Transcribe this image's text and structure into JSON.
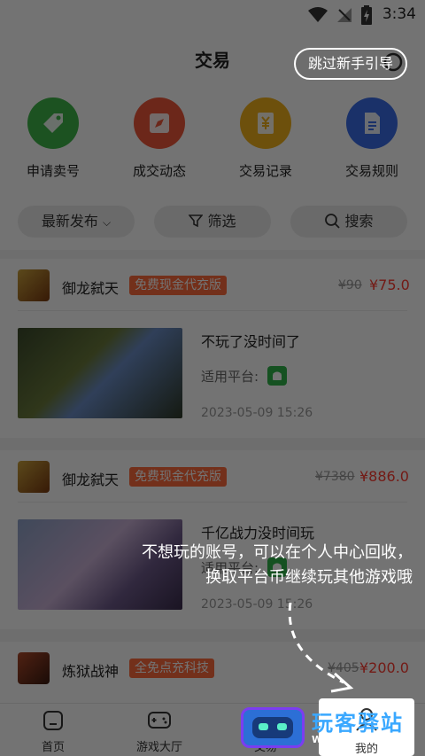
{
  "status_bar": {
    "time": "3:34"
  },
  "header": {
    "title": "交易",
    "skip_guide": "跳过新手引导"
  },
  "quick_menu": [
    {
      "label": "申请卖号",
      "icon": "tag-icon",
      "color": "#3fb54a"
    },
    {
      "label": "成交动态",
      "icon": "compass-icon",
      "color": "#f0583a"
    },
    {
      "label": "交易记录",
      "icon": "yen-record-icon",
      "color": "#f2b21b"
    },
    {
      "label": "交易规则",
      "icon": "document-icon",
      "color": "#3a6ee8"
    }
  ],
  "filters": {
    "sort": "最新发布",
    "filter": "筛选",
    "search": "搜索"
  },
  "listings": [
    {
      "game": "御龙弑天",
      "tag": "免费现金代充版",
      "old_price": "¥90",
      "price": "¥75.0",
      "title": "不玩了没时间了",
      "platform_label": "适用平台:",
      "datetime": "2023-05-09 15:26"
    },
    {
      "game": "御龙弑天",
      "tag": "免费现金代充版",
      "old_price": "¥7380",
      "price": "¥886.0",
      "title": "千亿战力没时间玩",
      "platform_label": "适用平台:",
      "datetime": "2023-05-09 15:26"
    },
    {
      "game": "炼狱战神",
      "tag": "全免点充科技",
      "old_price": "¥405",
      "price": "¥200.0"
    }
  ],
  "bottom_nav": [
    {
      "label": "首页",
      "icon": "home-icon"
    },
    {
      "label": "游戏大厅",
      "icon": "gamepad-icon"
    },
    {
      "label": "交易",
      "icon": "trade-icon"
    },
    {
      "label": "我的",
      "icon": "user-icon"
    }
  ],
  "guide": {
    "line1": "不想玩的账号，可以在个人中心回收，",
    "line2": "换取平台币继续玩其他游戏哦"
  },
  "watermark": {
    "name": "玩客驿站",
    "domain": "WODEGAME.CN"
  },
  "colors": {
    "accent": "#ff3b30",
    "tag": "#ff6a3d",
    "android": "#2fb34a"
  }
}
